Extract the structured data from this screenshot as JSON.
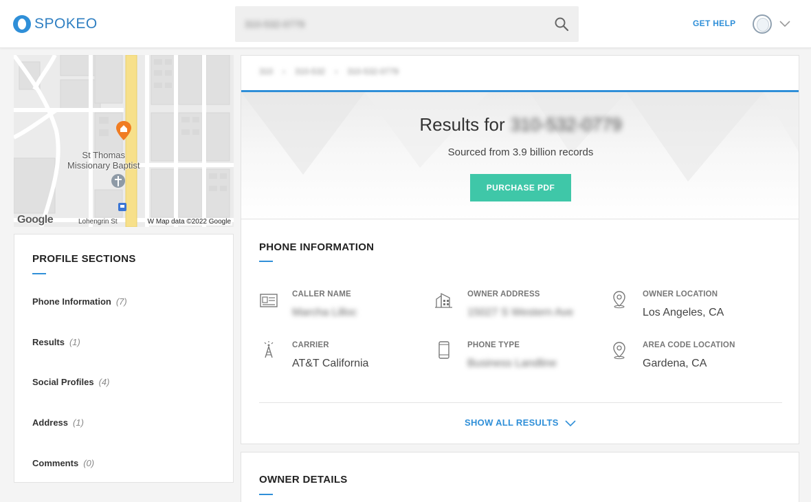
{
  "header": {
    "logo_text": "SPOKEO",
    "search_value": "310-532-0779",
    "get_help_label": "GET HELP"
  },
  "map": {
    "place_label_line1": "St Thomas",
    "place_label_line2": "Missionary Baptist",
    "street_label": "Lohengrin St",
    "credit": "W  Map data ©2022 Google",
    "google_mark": "Google"
  },
  "profile_sections": {
    "title": "PROFILE SECTIONS",
    "items": [
      {
        "label": "Phone Information",
        "count": "(7)"
      },
      {
        "label": "Results",
        "count": "(1)"
      },
      {
        "label": "Social Profiles",
        "count": "(4)"
      },
      {
        "label": "Address",
        "count": "(1)"
      },
      {
        "label": "Comments",
        "count": "(0)"
      }
    ]
  },
  "results": {
    "breadcrumb": [
      "310",
      "310-532",
      "310-532-0779"
    ],
    "title_prefix": "Results for",
    "title_number": "310-532-0779",
    "sourced_text": "Sourced from 3.9 billion records",
    "purchase_label": "PURCHASE PDF"
  },
  "phone_information": {
    "title": "PHONE INFORMATION",
    "fields": {
      "caller_name": {
        "label": "CALLER NAME",
        "value": "Marcha Lilloc",
        "icon": "id-card-icon"
      },
      "owner_address": {
        "label": "OWNER ADDRESS",
        "value": "15027 S Western Ave",
        "icon": "building-icon"
      },
      "owner_location": {
        "label": "OWNER LOCATION",
        "value": "Los Angeles, CA",
        "icon": "map-pin-icon"
      },
      "carrier": {
        "label": "CARRIER",
        "value": "AT&T California",
        "icon": "cell-tower-icon"
      },
      "phone_type": {
        "label": "PHONE TYPE",
        "value": "Business Landline",
        "icon": "mobile-phone-icon"
      },
      "area_code_location": {
        "label": "AREA CODE LOCATION",
        "value": "Gardena, CA",
        "icon": "map-pin-icon"
      }
    },
    "show_all_label": "SHOW ALL RESULTS"
  },
  "owner_details": {
    "title": "OWNER DETAILS"
  },
  "colors": {
    "accent_blue": "#2f8fd8",
    "purchase_green": "#3fc7a8",
    "map_road_yellow": "#f7e08a",
    "map_pin_orange": "#f07c22"
  }
}
